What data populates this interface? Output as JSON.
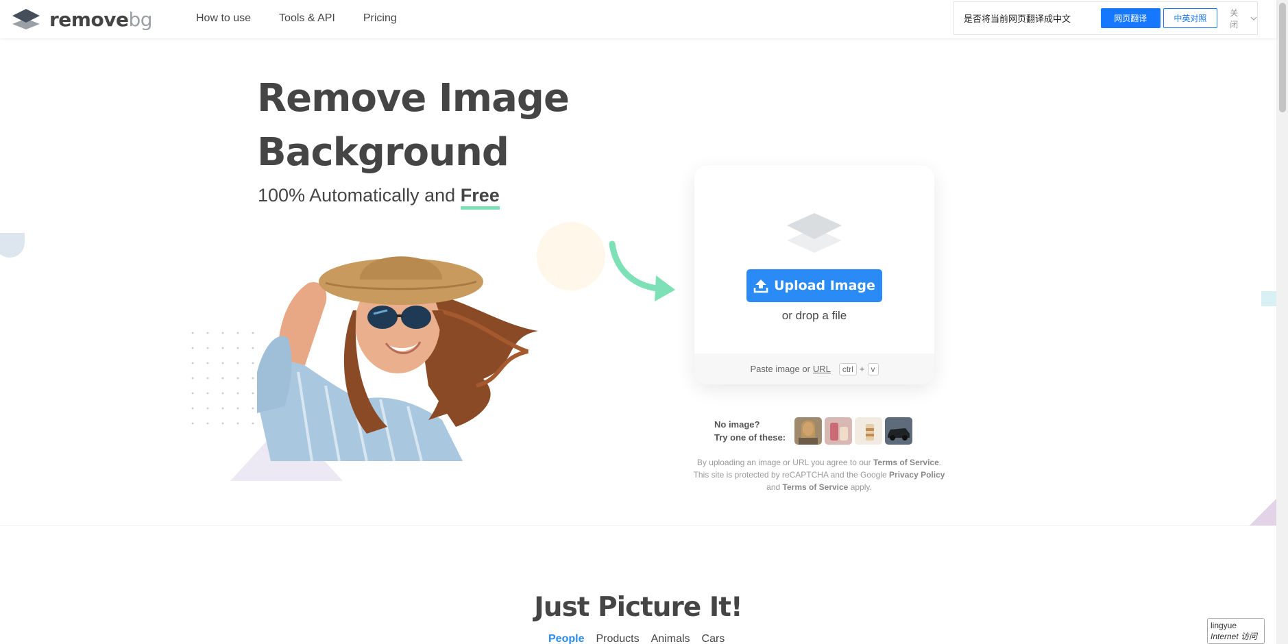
{
  "logo": {
    "name_main": "remove",
    "name_suffix": "bg"
  },
  "nav": {
    "items": [
      {
        "label": "How to use"
      },
      {
        "label": "Tools & API"
      },
      {
        "label": "Pricing"
      }
    ]
  },
  "translate_bar": {
    "message": "是否将当前网页翻译成中文",
    "translate_label": "网页翻译",
    "bilingual_label": "中英对照",
    "close_label": "关闭"
  },
  "hero": {
    "title": "Remove Image Background",
    "subtitle_prefix": "100% Automatically and",
    "subtitle_highlight": "Free"
  },
  "upload": {
    "button_label": "Upload Image",
    "drop_text": "or drop a file",
    "paste_prefix": "Paste image or",
    "paste_url": "URL",
    "key_ctrl": "ctrl",
    "key_plus": "+",
    "key_v": "v"
  },
  "samples": {
    "line1": "No image?",
    "line2": "Try one of these:"
  },
  "legal": {
    "p1": "By uploading an image or URL you agree to our",
    "tos1": "Terms of Service",
    "p2": ". This site is protected by reCAPTCHA and the Google",
    "privacy": "Privacy Policy",
    "p3": "and",
    "tos2": "Terms of Service",
    "p4": "apply."
  },
  "section": {
    "title": "Just Picture It!",
    "tabs": [
      {
        "label": "People"
      },
      {
        "label": "Products"
      },
      {
        "label": "Animals"
      },
      {
        "label": "Cars"
      }
    ]
  },
  "widget": {
    "line1": "lingyue",
    "line2": "Internet 访问"
  },
  "colors": {
    "accent": "#2a8af6",
    "underline": "#7ee0b6",
    "arrow": "#7ee0b6"
  },
  "icons": [
    "logo-layers-icon",
    "upload-icon",
    "layers-icon",
    "arrow-icon",
    "chevron-down-icon"
  ]
}
